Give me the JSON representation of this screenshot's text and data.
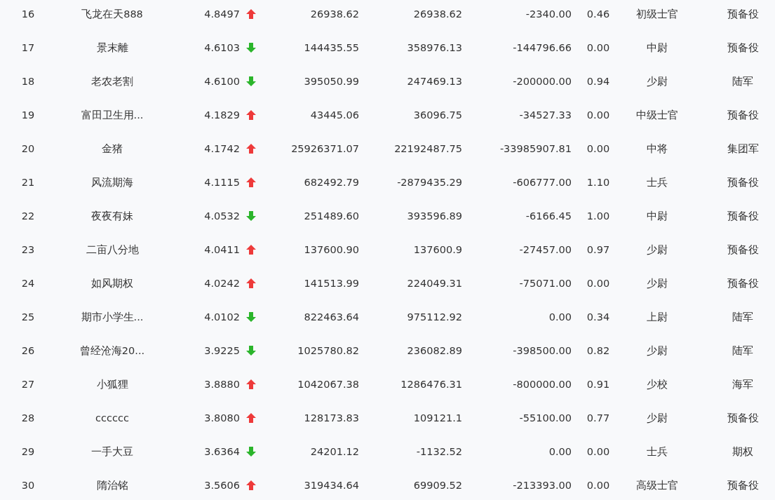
{
  "rows": [
    {
      "rank": "16",
      "name": "飞龙在天888",
      "score": "4.8497",
      "rising": true,
      "col_4": "26938.62",
      "col_5": "26938.62",
      "col_6": "-2340.00",
      "col_7": "0.46",
      "rank_title": "初级士官",
      "branch": "预备役"
    },
    {
      "rank": "17",
      "name": "景末離",
      "score": "4.6103",
      "rising": false,
      "col_4": "144435.55",
      "col_5": "358976.13",
      "col_6": "-144796.66",
      "col_7": "0.00",
      "rank_title": "中尉",
      "branch": "预备役"
    },
    {
      "rank": "18",
      "name": "老农老割",
      "score": "4.6100",
      "rising": false,
      "col_4": "395050.99",
      "col_5": "247469.13",
      "col_6": "-200000.00",
      "col_7": "0.94",
      "rank_title": "少尉",
      "branch": "陆军"
    },
    {
      "rank": "19",
      "name": "富田卫生用...",
      "score": "4.1829",
      "rising": true,
      "col_4": "43445.06",
      "col_5": "36096.75",
      "col_6": "-34527.33",
      "col_7": "0.00",
      "rank_title": "中级士官",
      "branch": "预备役"
    },
    {
      "rank": "20",
      "name": "金猪",
      "score": "4.1742",
      "rising": true,
      "col_4": "25926371.07",
      "col_5": "22192487.75",
      "col_6": "-33985907.81",
      "col_7": "0.00",
      "rank_title": "中将",
      "branch": "集团军"
    },
    {
      "rank": "21",
      "name": "风流期海",
      "score": "4.1115",
      "rising": true,
      "col_4": "682492.79",
      "col_5": "-2879435.29",
      "col_6": "-606777.00",
      "col_7": "1.10",
      "rank_title": "士兵",
      "branch": "预备役"
    },
    {
      "rank": "22",
      "name": "夜夜有妹",
      "score": "4.0532",
      "rising": false,
      "col_4": "251489.60",
      "col_5": "393596.89",
      "col_6": "-6166.45",
      "col_7": "1.00",
      "rank_title": "中尉",
      "branch": "预备役"
    },
    {
      "rank": "23",
      "name": "二亩八分地",
      "score": "4.0411",
      "rising": true,
      "col_4": "137600.90",
      "col_5": "137600.9",
      "col_6": "-27457.00",
      "col_7": "0.97",
      "rank_title": "少尉",
      "branch": "预备役"
    },
    {
      "rank": "24",
      "name": "如风期权",
      "score": "4.0242",
      "rising": true,
      "col_4": "141513.99",
      "col_5": "224049.31",
      "col_6": "-75071.00",
      "col_7": "0.00",
      "rank_title": "少尉",
      "branch": "预备役"
    },
    {
      "rank": "25",
      "name": "期市小学生...",
      "score": "4.0102",
      "rising": false,
      "col_4": "822463.64",
      "col_5": "975112.92",
      "col_6": "0.00",
      "col_7": "0.34",
      "rank_title": "上尉",
      "branch": "陆军"
    },
    {
      "rank": "26",
      "name": "曾经沧海20...",
      "score": "3.9225",
      "rising": false,
      "col_4": "1025780.82",
      "col_5": "236082.89",
      "col_6": "-398500.00",
      "col_7": "0.82",
      "rank_title": "少尉",
      "branch": "陆军"
    },
    {
      "rank": "27",
      "name": "小狐狸",
      "score": "3.8880",
      "rising": true,
      "col_4": "1042067.38",
      "col_5": "1286476.31",
      "col_6": "-800000.00",
      "col_7": "0.91",
      "rank_title": "少校",
      "branch": "海军"
    },
    {
      "rank": "28",
      "name": "cccccc",
      "score": "3.8080",
      "rising": true,
      "col_4": "128173.83",
      "col_5": "109121.1",
      "col_6": "-55100.00",
      "col_7": "0.77",
      "rank_title": "少尉",
      "branch": "预备役"
    },
    {
      "rank": "29",
      "name": "一手大豆",
      "score": "3.6364",
      "rising": false,
      "col_4": "24201.12",
      "col_5": "-1132.52",
      "col_6": "0.00",
      "col_7": "0.00",
      "rank_title": "士兵",
      "branch": "期权"
    },
    {
      "rank": "30",
      "name": "隋治铭",
      "score": "3.5606",
      "rising": true,
      "col_4": "319434.64",
      "col_5": "69909.52",
      "col_6": "-213393.00",
      "col_7": "0.00",
      "rank_title": "高级士官",
      "branch": "预备役"
    }
  ]
}
